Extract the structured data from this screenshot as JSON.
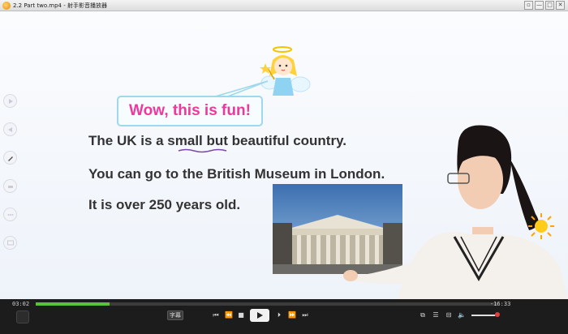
{
  "window": {
    "title": "2.2 Part two.mp4 - 射手影音播放器",
    "buttons": [
      "▫",
      "—",
      "□",
      "✕"
    ]
  },
  "slide": {
    "bubble_text": "Wow, this is fun!",
    "lines": [
      "The UK is a small but beautiful country.",
      "You can go to the British Museum in London.",
      "It is over 250 years old."
    ],
    "underlined_word": "small"
  },
  "player": {
    "time_elapsed": "03:02",
    "time_remaining": "-16:33",
    "progress": 0.16,
    "volume": 0.85,
    "subtitle_label": "字幕",
    "accent_color": "#58c23a"
  }
}
